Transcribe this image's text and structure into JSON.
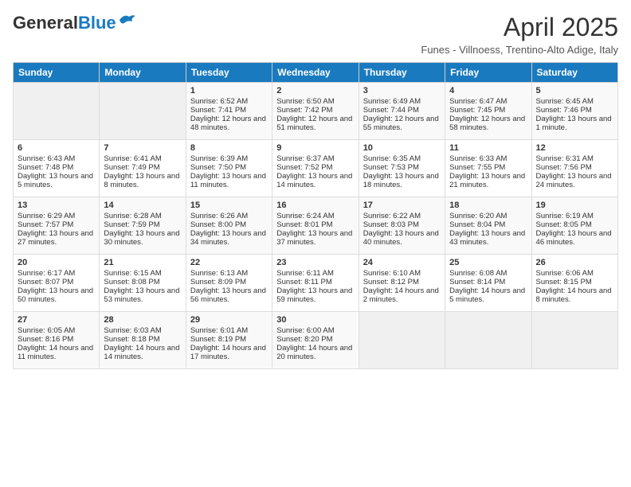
{
  "logo": {
    "general": "General",
    "blue": "Blue"
  },
  "title": "April 2025",
  "location": "Funes - Villnoess, Trentino-Alto Adige, Italy",
  "days_of_week": [
    "Sunday",
    "Monday",
    "Tuesday",
    "Wednesday",
    "Thursday",
    "Friday",
    "Saturday"
  ],
  "weeks": [
    [
      {
        "day": "",
        "info": ""
      },
      {
        "day": "",
        "info": ""
      },
      {
        "day": "1",
        "info": "Sunrise: 6:52 AM\nSunset: 7:41 PM\nDaylight: 12 hours and 48 minutes."
      },
      {
        "day": "2",
        "info": "Sunrise: 6:50 AM\nSunset: 7:42 PM\nDaylight: 12 hours and 51 minutes."
      },
      {
        "day": "3",
        "info": "Sunrise: 6:49 AM\nSunset: 7:44 PM\nDaylight: 12 hours and 55 minutes."
      },
      {
        "day": "4",
        "info": "Sunrise: 6:47 AM\nSunset: 7:45 PM\nDaylight: 12 hours and 58 minutes."
      },
      {
        "day": "5",
        "info": "Sunrise: 6:45 AM\nSunset: 7:46 PM\nDaylight: 13 hours and 1 minute."
      }
    ],
    [
      {
        "day": "6",
        "info": "Sunrise: 6:43 AM\nSunset: 7:48 PM\nDaylight: 13 hours and 5 minutes."
      },
      {
        "day": "7",
        "info": "Sunrise: 6:41 AM\nSunset: 7:49 PM\nDaylight: 13 hours and 8 minutes."
      },
      {
        "day": "8",
        "info": "Sunrise: 6:39 AM\nSunset: 7:50 PM\nDaylight: 13 hours and 11 minutes."
      },
      {
        "day": "9",
        "info": "Sunrise: 6:37 AM\nSunset: 7:52 PM\nDaylight: 13 hours and 14 minutes."
      },
      {
        "day": "10",
        "info": "Sunrise: 6:35 AM\nSunset: 7:53 PM\nDaylight: 13 hours and 18 minutes."
      },
      {
        "day": "11",
        "info": "Sunrise: 6:33 AM\nSunset: 7:55 PM\nDaylight: 13 hours and 21 minutes."
      },
      {
        "day": "12",
        "info": "Sunrise: 6:31 AM\nSunset: 7:56 PM\nDaylight: 13 hours and 24 minutes."
      }
    ],
    [
      {
        "day": "13",
        "info": "Sunrise: 6:29 AM\nSunset: 7:57 PM\nDaylight: 13 hours and 27 minutes."
      },
      {
        "day": "14",
        "info": "Sunrise: 6:28 AM\nSunset: 7:59 PM\nDaylight: 13 hours and 30 minutes."
      },
      {
        "day": "15",
        "info": "Sunrise: 6:26 AM\nSunset: 8:00 PM\nDaylight: 13 hours and 34 minutes."
      },
      {
        "day": "16",
        "info": "Sunrise: 6:24 AM\nSunset: 8:01 PM\nDaylight: 13 hours and 37 minutes."
      },
      {
        "day": "17",
        "info": "Sunrise: 6:22 AM\nSunset: 8:03 PM\nDaylight: 13 hours and 40 minutes."
      },
      {
        "day": "18",
        "info": "Sunrise: 6:20 AM\nSunset: 8:04 PM\nDaylight: 13 hours and 43 minutes."
      },
      {
        "day": "19",
        "info": "Sunrise: 6:19 AM\nSunset: 8:05 PM\nDaylight: 13 hours and 46 minutes."
      }
    ],
    [
      {
        "day": "20",
        "info": "Sunrise: 6:17 AM\nSunset: 8:07 PM\nDaylight: 13 hours and 50 minutes."
      },
      {
        "day": "21",
        "info": "Sunrise: 6:15 AM\nSunset: 8:08 PM\nDaylight: 13 hours and 53 minutes."
      },
      {
        "day": "22",
        "info": "Sunrise: 6:13 AM\nSunset: 8:09 PM\nDaylight: 13 hours and 56 minutes."
      },
      {
        "day": "23",
        "info": "Sunrise: 6:11 AM\nSunset: 8:11 PM\nDaylight: 13 hours and 59 minutes."
      },
      {
        "day": "24",
        "info": "Sunrise: 6:10 AM\nSunset: 8:12 PM\nDaylight: 14 hours and 2 minutes."
      },
      {
        "day": "25",
        "info": "Sunrise: 6:08 AM\nSunset: 8:14 PM\nDaylight: 14 hours and 5 minutes."
      },
      {
        "day": "26",
        "info": "Sunrise: 6:06 AM\nSunset: 8:15 PM\nDaylight: 14 hours and 8 minutes."
      }
    ],
    [
      {
        "day": "27",
        "info": "Sunrise: 6:05 AM\nSunset: 8:16 PM\nDaylight: 14 hours and 11 minutes."
      },
      {
        "day": "28",
        "info": "Sunrise: 6:03 AM\nSunset: 8:18 PM\nDaylight: 14 hours and 14 minutes."
      },
      {
        "day": "29",
        "info": "Sunrise: 6:01 AM\nSunset: 8:19 PM\nDaylight: 14 hours and 17 minutes."
      },
      {
        "day": "30",
        "info": "Sunrise: 6:00 AM\nSunset: 8:20 PM\nDaylight: 14 hours and 20 minutes."
      },
      {
        "day": "",
        "info": ""
      },
      {
        "day": "",
        "info": ""
      },
      {
        "day": "",
        "info": ""
      }
    ]
  ]
}
